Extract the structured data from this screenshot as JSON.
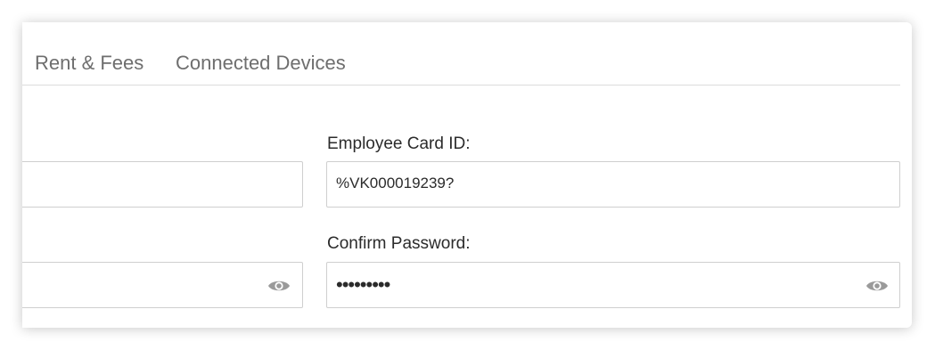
{
  "tabs": {
    "rent_fees": "Rent & Fees",
    "connected_devices": "Connected Devices"
  },
  "form": {
    "employee_card_id": {
      "label": "Employee Card ID:",
      "value": "%VK000019239?"
    },
    "confirm_password": {
      "label": "Confirm Password:",
      "value": "•••••••••"
    }
  },
  "icons": {
    "password_toggle": "eye-icon"
  },
  "colors": {
    "tab_text": "#6e6e6e",
    "label_text": "#2b2b2b",
    "border": "#cfcfcf",
    "icon": "#9a9a9a"
  }
}
